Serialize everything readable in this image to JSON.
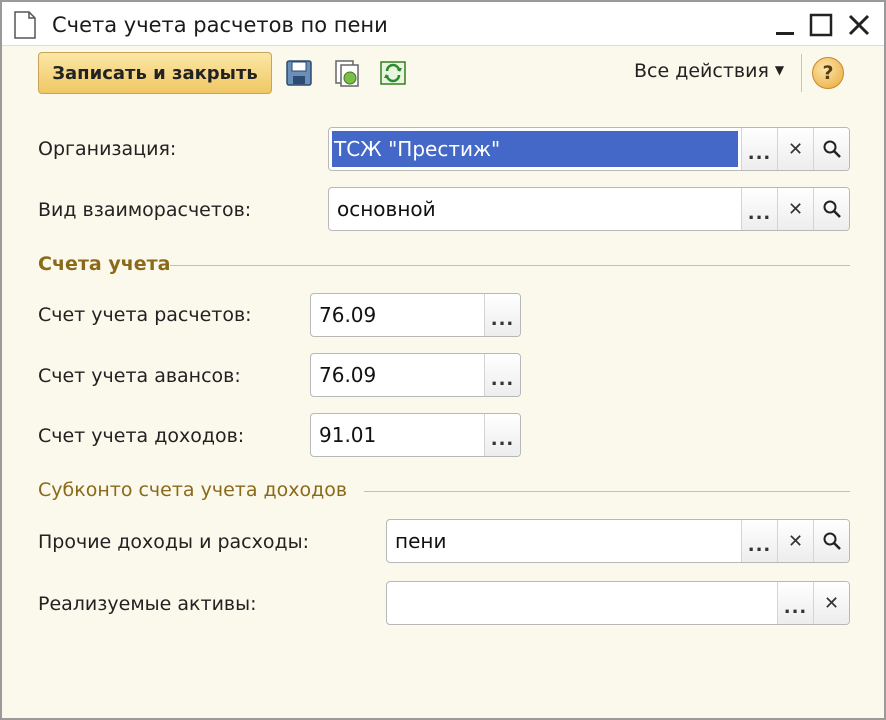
{
  "window": {
    "title": "Счета учета расчетов по пени"
  },
  "toolbar": {
    "save_close_label": "Записать и закрыть",
    "all_actions_label": "Все действия",
    "help_label": "?"
  },
  "form": {
    "organization": {
      "label": "Организация:",
      "value": "ТСЖ \"Престиж\""
    },
    "settlement_type": {
      "label": "Вид взаиморасчетов:",
      "value": "основной"
    },
    "accounts_group": {
      "title": "Счета учета",
      "settlement_account": {
        "label": "Счет учета расчетов:",
        "value": "76.09"
      },
      "advance_account": {
        "label": "Счет учета авансов:",
        "value": "76.09"
      },
      "income_account": {
        "label": "Счет учета доходов:",
        "value": "91.01"
      }
    },
    "subconto_group": {
      "title": "Субконто счета учета доходов",
      "other_income": {
        "label": "Прочие доходы и расходы:",
        "value": "пени"
      },
      "assets": {
        "label": "Реализуемые активы:",
        "value": ""
      }
    }
  },
  "buttons": {
    "select": "...",
    "clear": "✕"
  },
  "colors": {
    "background": "#fbf8ec",
    "accent_button": "#f0c765",
    "selection": "#4468c8",
    "group_title": "#8a6a1a"
  }
}
